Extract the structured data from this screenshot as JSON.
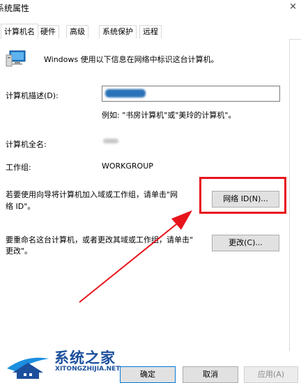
{
  "window": {
    "title": "系统属性",
    "close_glyph": "×"
  },
  "tabs": [
    {
      "label": "计算机名",
      "active": true
    },
    {
      "label": "硬件"
    },
    {
      "label": "高级"
    },
    {
      "label": "系统保护"
    },
    {
      "label": "远程"
    }
  ],
  "computer_name_tab": {
    "intro": "Windows 使用以下信息在网络中标识这台计算机。",
    "description_label": "计算机描述(D):",
    "description_example": "例如: \"书房计算机\"或\"美玲的计算机\"。",
    "full_name_label": "计算机全名:",
    "workgroup_label": "工作组:",
    "workgroup_value": "WORKGROUP",
    "network_id_text_line1": "若要使用向导将计算机加入域或工作组，请单击\"网",
    "network_id_text_line2": "络 ID\"。",
    "network_id_button": "网络 ID(N)...",
    "rename_text_line1": "要重命名这台计算机，或者更改其域或工作组，请单击\"",
    "rename_text_line2": "更改\"。",
    "change_button": "更改(C)..."
  },
  "footer": {
    "ok": "确定",
    "cancel": "取消",
    "apply": "应用(A)"
  },
  "watermark": {
    "name": "系统之家",
    "url": "XITONGZHIJIA.NET"
  },
  "colors": {
    "highlight": "#e8141c",
    "arrow": "#e8141c",
    "watermark": "#1c4f9c"
  }
}
